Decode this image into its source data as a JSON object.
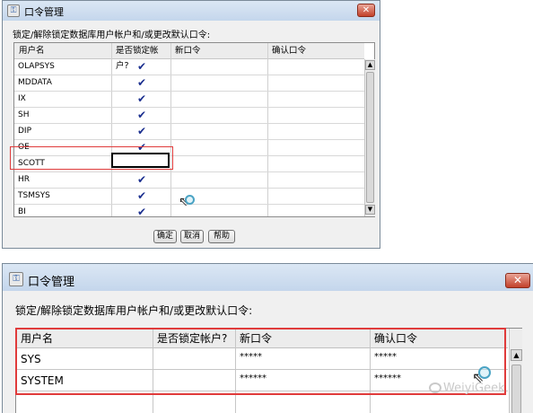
{
  "top_dialog": {
    "title": "口令管理",
    "close_label": "✕",
    "instruction": "锁定/解除锁定数据库用户帐户和/或更改默认口令:",
    "columns": [
      "用户名",
      "是否锁定帐户?",
      "新口令",
      "确认口令"
    ],
    "rows": [
      {
        "user": "OLAPSYS",
        "locked": "✔"
      },
      {
        "user": "MDDATA",
        "locked": "✔"
      },
      {
        "user": "IX",
        "locked": "✔"
      },
      {
        "user": "SH",
        "locked": "✔"
      },
      {
        "user": "DIP",
        "locked": "✔"
      },
      {
        "user": "OE",
        "locked": "✔"
      },
      {
        "user": "SCOTT",
        "locked": ""
      },
      {
        "user": "HR",
        "locked": "✔"
      },
      {
        "user": "TSMSYS",
        "locked": "✔"
      },
      {
        "user": "BI",
        "locked": "✔"
      }
    ],
    "buttons": {
      "ok": "确定",
      "cancel": "取消",
      "help": "帮助"
    }
  },
  "bottom_dialog": {
    "title": "口令管理",
    "close_label": "✕",
    "instruction": "锁定/解除锁定数据库用户帐户和/或更改默认口令:",
    "columns": [
      "用户名",
      "是否锁定帐户?",
      "新口令",
      "确认口令"
    ],
    "rows": [
      {
        "user": "SYS",
        "new_password": "*****",
        "confirm_password": "*****"
      },
      {
        "user": "SYSTEM",
        "new_password": "******",
        "confirm_password": "******"
      }
    ]
  },
  "watermark": "WeiyiGeek",
  "icons": {
    "app": "key-icon",
    "scroll_up": "chevron-up-icon",
    "scroll_down": "chevron-down-icon",
    "cursor": "cursor-icon",
    "magnifier": "magnifier-icon"
  },
  "colors": {
    "highlight": "#e03b3b",
    "check": "#1b2f8f",
    "titlebar": "#c4d6ec"
  }
}
